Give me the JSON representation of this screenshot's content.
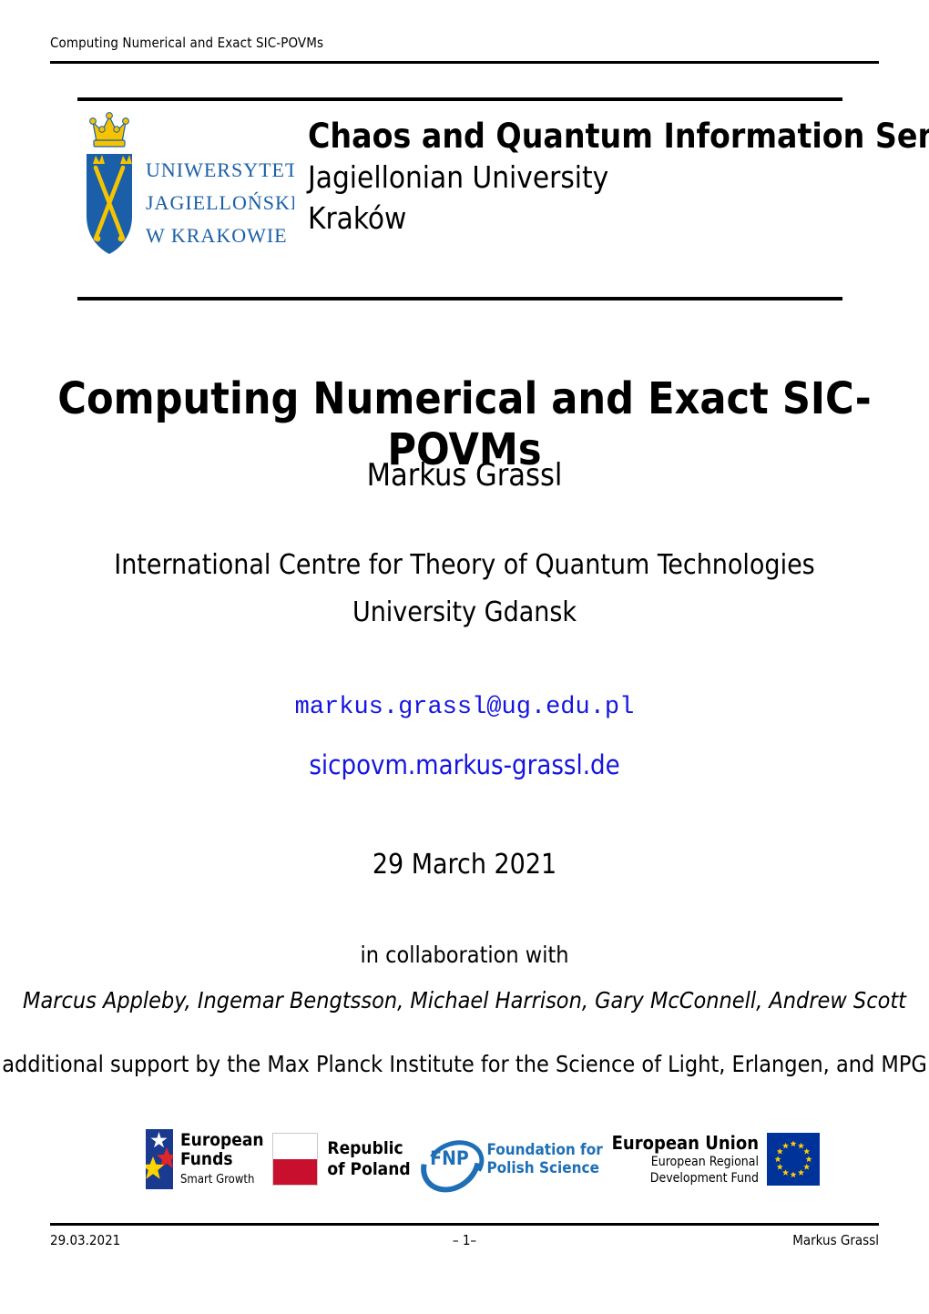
{
  "running_header": {
    "text": "Computing Numerical and Exact SIC-POVMs"
  },
  "title_block": {
    "logo": {
      "name": "jagiellonian-university-logo",
      "lines": [
        "UNIWERSYTET",
        "JAGIELLOŃSKI",
        "W KRAKOWIE"
      ],
      "shield_color": "#1a5fa8",
      "crown_color": "#f5c300"
    },
    "seminar_name": "Chaos and Quantum Information Seminar",
    "institution": "Jagiellonian University",
    "city": "Kraków"
  },
  "main": {
    "title": "Computing Numerical and Exact SIC-POVMs",
    "author": "Markus Grassl",
    "affiliation_line1": "International Centre for Theory of Quantum Technologies",
    "affiliation_line2": "University Gdansk",
    "email": "markus.grassl@ug.edu.pl",
    "website": "sicpovm.markus-grassl.de",
    "link_color": "#1515e0",
    "date": "29 March 2021",
    "collaboration_heading": "in collaboration with",
    "collaborators": "Marcus Appleby, Ingemar Bengtsson, Michael Harrison, Gary McConnell, Andrew Scott",
    "support": "additional support by the Max Planck Institute for the Science of Light, Erlangen, and MPG"
  },
  "funders": [
    {
      "id": "european-funds",
      "line1": "European",
      "line2": "Funds",
      "line3": "Smart Growth",
      "mark_color": "#1a3a8f"
    },
    {
      "id": "republic-of-poland",
      "line1": "Republic",
      "line2": "of Poland",
      "flag_red": "#c8102e"
    },
    {
      "id": "foundation-for-polish-science",
      "acronym": "FNP",
      "line1": "Foundation for",
      "line2": "Polish Science",
      "brand_color": "#1e6fb5"
    },
    {
      "id": "european-union",
      "line1": "European Union",
      "line2": "European Regional",
      "line3": "Development Fund",
      "flag_blue": "#003399",
      "star_color": "#ffcc00"
    }
  ],
  "footer": {
    "date": "29.03.2021",
    "page": "– 1–",
    "author": "Markus Grassl"
  }
}
